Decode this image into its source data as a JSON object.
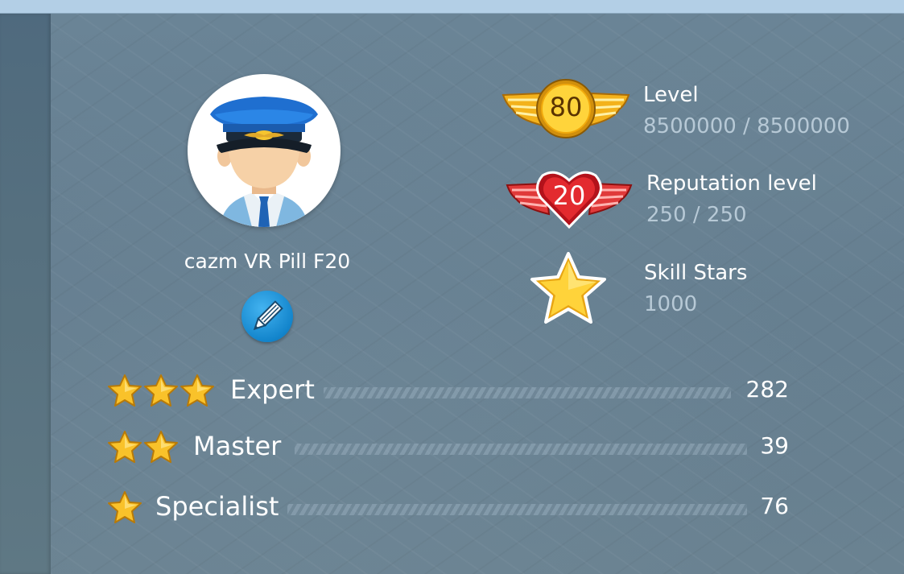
{
  "player": {
    "name": "cazm VR Pill F20"
  },
  "stats": {
    "level": {
      "badge_value": "80",
      "title": "Level",
      "value": "8500000 / 8500000"
    },
    "reputation": {
      "badge_value": "20",
      "title": "Reputation level",
      "value": "250 / 250"
    },
    "skill_stars": {
      "title": "Skill Stars",
      "value": "1000"
    }
  },
  "ranks": [
    {
      "stars": 3,
      "label": "Expert",
      "count": "282"
    },
    {
      "stars": 2,
      "label": "Master",
      "count": "39"
    },
    {
      "stars": 1,
      "label": "Specialist",
      "count": "76"
    }
  ],
  "colors": {
    "topbar": "#b3cfe6",
    "panel": "#647d8f",
    "gold": "#f6c21e",
    "red": "#d8262e",
    "edit_blue": "#1a8fd4"
  },
  "icons": {
    "avatar": "pilot-avatar-icon",
    "edit": "pencil-icon",
    "level": "gold-wings-badge-icon",
    "reputation": "red-heart-wings-badge-icon",
    "skill": "gold-star-icon"
  }
}
